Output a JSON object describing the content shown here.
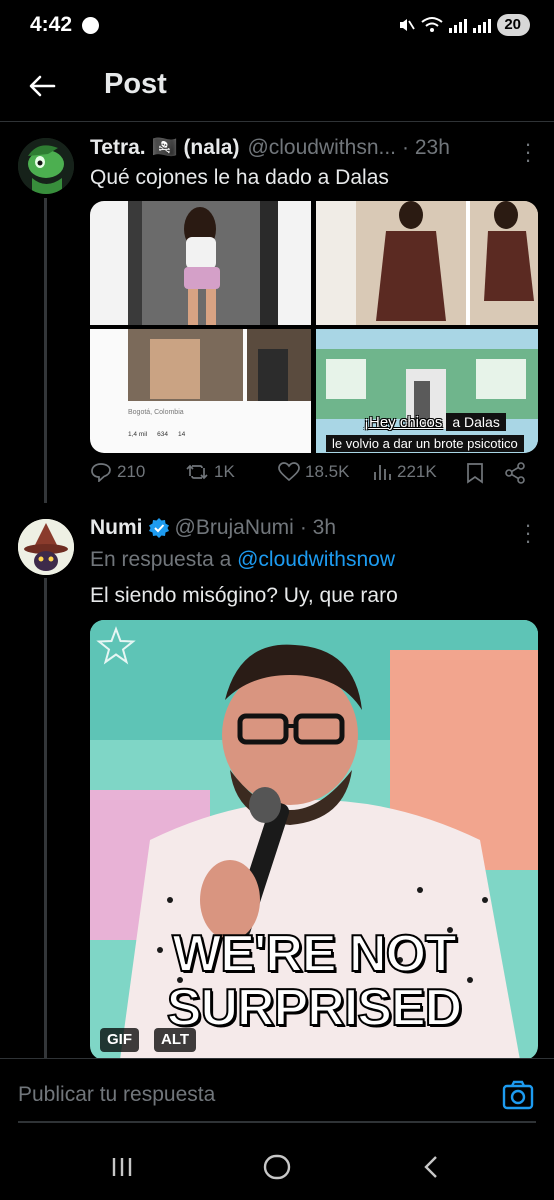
{
  "status_bar": {
    "time": "4:42",
    "battery": "20"
  },
  "header": {
    "title": "Post"
  },
  "tweets": [
    {
      "name": "Tetra. 🏴‍☠️ (nala)",
      "handle": "@cloudwithsn...",
      "time": "· 23h",
      "text": "Qué cojones le ha dado a Dalas",
      "media": {
        "location": "Bogotá, Colombia",
        "likes": "1,4 mil",
        "comments": "634",
        "reposts": "14",
        "caption_top": "¡Hey chicos",
        "caption_tag": "a Dalas",
        "caption_bottom": "le volvio a dar un brote psicotico"
      },
      "stats": {
        "replies": "210",
        "reposts": "1K",
        "likes": "18.5K",
        "views": "221K"
      }
    },
    {
      "name": "Numi",
      "handle": "@BrujaNumi",
      "time": "· 3h",
      "reply_prefix": "En respuesta a",
      "reply_to": "@cloudwithsnow",
      "text": "El siendo misógino? Uy, que raro",
      "gif": {
        "caption_line1": "WE'RE NOT",
        "caption_line2": "SURPRISED",
        "badge_gif": "GIF",
        "badge_alt": "ALT"
      }
    }
  ],
  "composer": {
    "placeholder": "Publicar tu respuesta"
  },
  "colors": {
    "accent": "#1d9bf0",
    "muted": "#71767b",
    "background": "#000000"
  }
}
